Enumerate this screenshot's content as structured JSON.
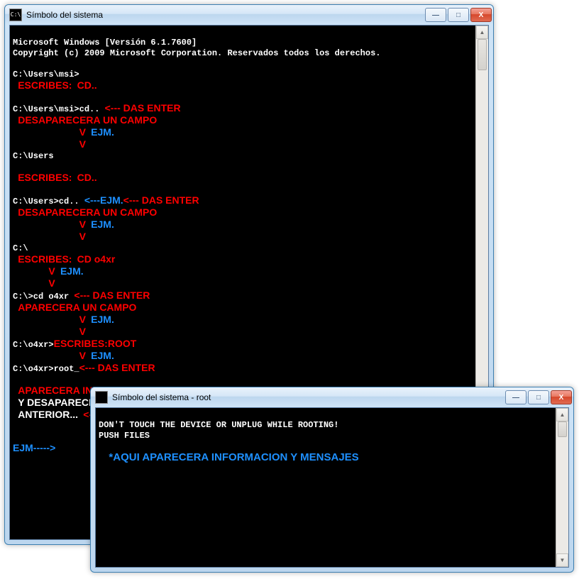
{
  "window1": {
    "title": "Símbolo del sistema",
    "icon_text": "C:\\",
    "lines": {
      "l1": "Microsoft Windows [Versión 6.1.7600]",
      "l2": "Copyright (c) 2009 Microsoft Corporation. Reservados todos los derechos.",
      "l3": "C:\\Users\\msi>",
      "l4": "C:\\Users\\msi>cd..",
      "l5": "C:\\Users",
      "l6": "C:\\Users>cd..",
      "l7": "C:\\",
      "l8": "C:\\>cd o4xr",
      "l9": "C:\\o4xr>",
      "l10": "C:\\o4xr>root_"
    },
    "ann": {
      "escribes": "ESCRIBES:",
      "cd_dotdot": "CD..",
      "das_enter": "<--- DAS ENTER",
      "desaparecera": "DESAPARECERA UN CAMPO",
      "ejm": "EJM.",
      "arrow_down": "V",
      "ejm_inline": "<---EJM.",
      "cd_o4xr": "CD o4xr",
      "aparecera_campo": "APARECERA UN CAMPO",
      "escribes_root": "ESCRIBES:",
      "root": "ROOT",
      "aparecera_info": "APARECERA INFORMACION",
      "y_desaparecera": "Y DESAPARECERA LA",
      "anterior": "ANTERIOR...",
      "arrow_left": "<----",
      "ejm_arrow": "EJM----->"
    }
  },
  "window2": {
    "title": "Símbolo del sistema - root",
    "icon_text": " ",
    "lines": {
      "l1": "DON'T TOUCH THE DEVICE OR UNPLUG WHILE ROOTING!",
      "l2": "PUSH FILES"
    },
    "ann": {
      "msg": "*AQUI APARECERA INFORMACION  Y MENSAJES"
    }
  },
  "buttons": {
    "minimize": "—",
    "maximize": "□",
    "close": "X",
    "scroll_up": "▲",
    "scroll_down": "▼"
  }
}
